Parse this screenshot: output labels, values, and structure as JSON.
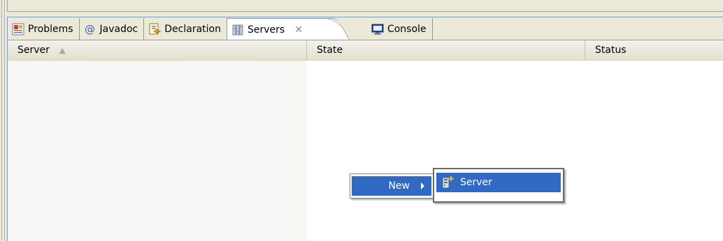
{
  "tabs": [
    {
      "label": "Problems",
      "icon": "problems-icon"
    },
    {
      "label": "Javadoc",
      "icon": "javadoc-icon"
    },
    {
      "label": "Declaration",
      "icon": "declaration-icon"
    },
    {
      "label": "Servers",
      "icon": "servers-icon",
      "active": true
    },
    {
      "label": "Console",
      "icon": "console-icon"
    }
  ],
  "columns": {
    "server": "Server",
    "state": "State",
    "status": "Status"
  },
  "context_menu": {
    "new_label": "New",
    "submenu_server_label": "Server"
  },
  "colors": {
    "selection": "#316ac5",
    "background": "#ece9d8"
  }
}
